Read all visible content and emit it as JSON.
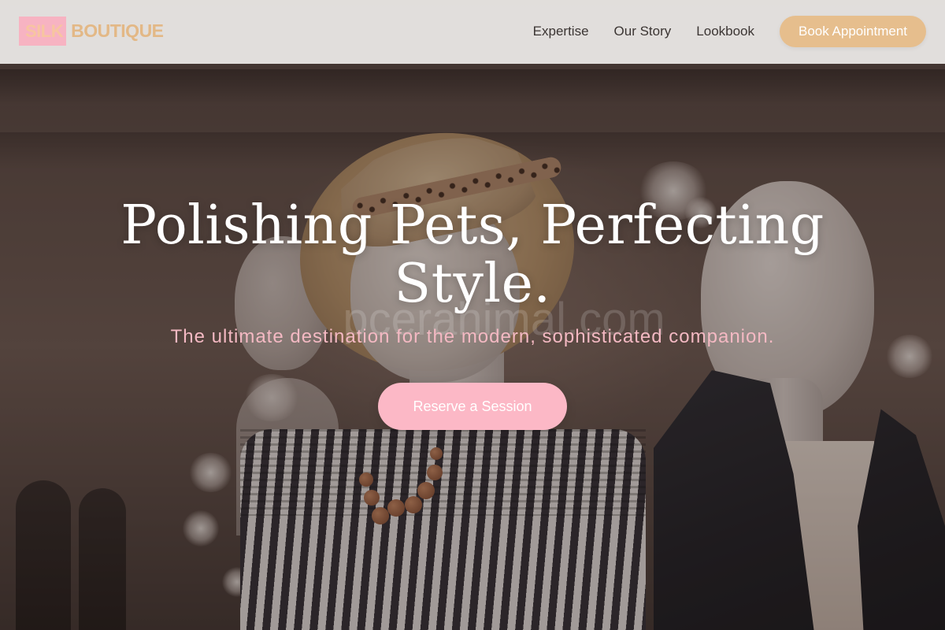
{
  "brand": {
    "logo_mark": "SILK",
    "logo_text": "BOUTIQUE"
  },
  "nav": {
    "links": [
      "Expertise",
      "Our Story",
      "Lookbook"
    ],
    "cta_label": "Book Appointment"
  },
  "hero": {
    "title": "Polishing Pets, Perfecting Style.",
    "subtitle": "The ultimate destination for the modern, sophisticated companion.",
    "cta_label": "Reserve a Session",
    "watermark": "pcerahimal.com"
  },
  "colors": {
    "header_bg": "#e8e5e3",
    "logo_mark_bg": "#f7b3c2",
    "logo_text": "#e3b886",
    "nav_cta_bg": "#e6be8d",
    "hero_cta_bg": "#fcb8c6",
    "subtitle": "#f4b9c3",
    "title": "#ffffff"
  }
}
